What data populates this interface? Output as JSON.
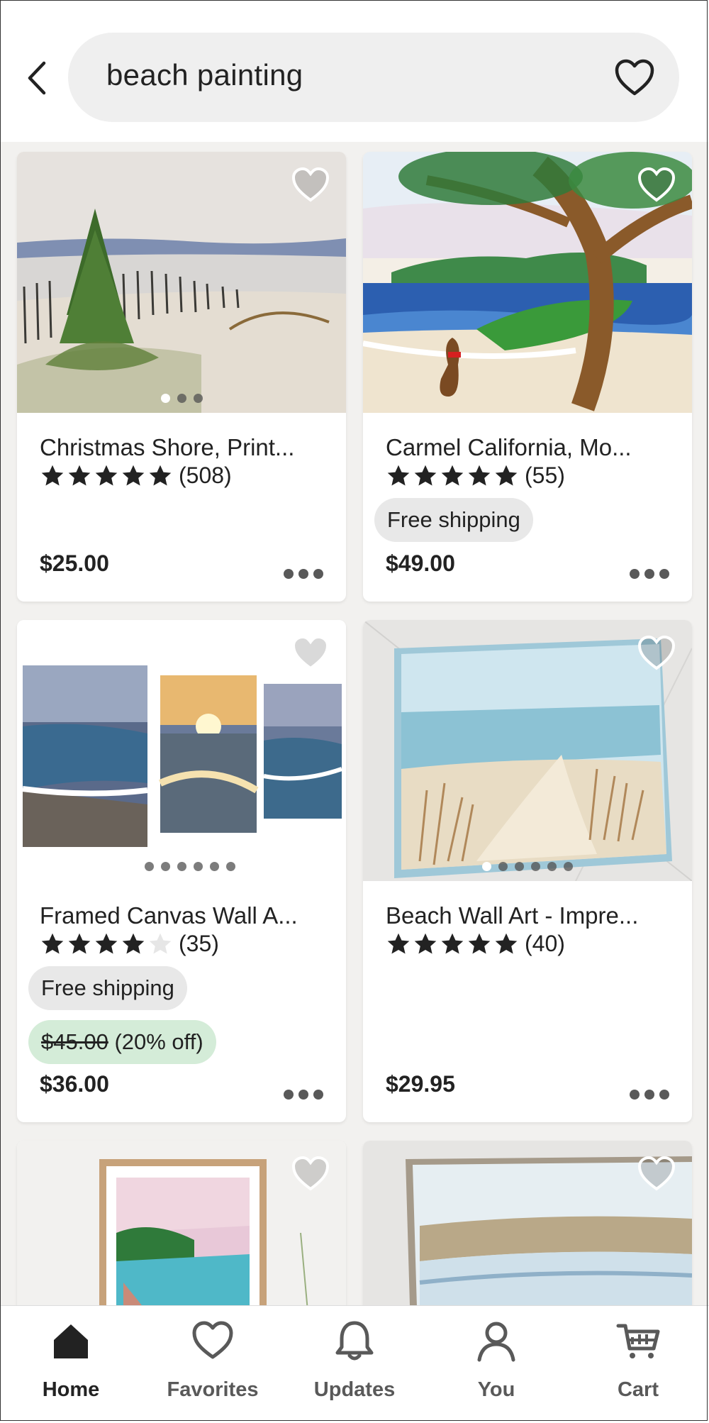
{
  "search": {
    "query": "beach painting"
  },
  "listings": [
    {
      "title": "Christmas Shore, Print...",
      "rating": 5,
      "reviews": "(508)",
      "price": "$25.00"
    },
    {
      "title": "Carmel California, Mo...",
      "rating": 5,
      "reviews": "(55)",
      "free_shipping": "Free shipping",
      "price": "$49.00"
    },
    {
      "title": "Framed Canvas Wall A...",
      "rating": 4,
      "reviews": "(35)",
      "free_shipping": "Free shipping",
      "original_price": "$45.00",
      "discount": "(20% off)",
      "price": "$36.00"
    },
    {
      "title": "Beach Wall Art - Impre...",
      "rating": 5,
      "reviews": "(40)",
      "price": "$29.95"
    }
  ],
  "nav": {
    "items": [
      {
        "label": "Home",
        "icon": "home-icon",
        "active": true
      },
      {
        "label": "Favorites",
        "icon": "heart-icon"
      },
      {
        "label": "Updates",
        "icon": "bell-icon"
      },
      {
        "label": "You",
        "icon": "person-icon"
      },
      {
        "label": "Cart",
        "icon": "cart-icon"
      }
    ]
  },
  "colors": {
    "accent_green_chip": "#d4ecd8",
    "chip_gray": "#e8e8e8",
    "text": "#222222"
  }
}
